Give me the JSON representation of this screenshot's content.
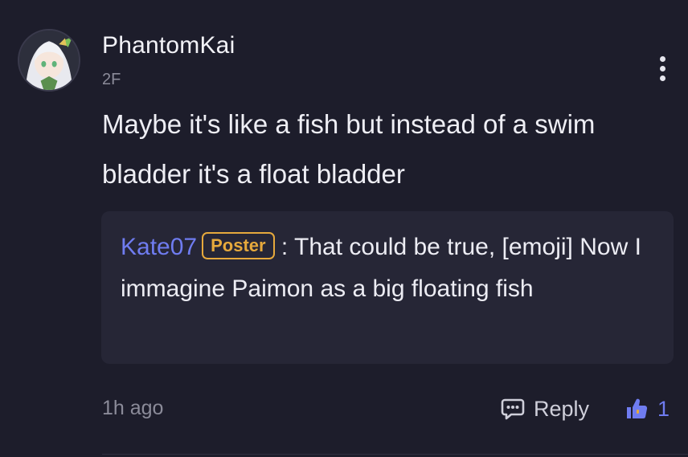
{
  "comment": {
    "username": "PhantomKai",
    "floor": "2F",
    "text": "Maybe it's like a fish but instead of a swim bladder it's a float bladder",
    "quote": {
      "author": "Kate07",
      "badge": "Poster",
      "separator": " : ",
      "text": "That could be true, [emoji] Now I immagine Paimon as a big floating fish"
    },
    "time": "1h ago",
    "reply_label": "Reply",
    "like_count": "1"
  },
  "icons": {
    "more": "more-vertical-icon",
    "reply": "comment-bubble-icon",
    "like": "thumbs-up-icon"
  },
  "colors": {
    "background": "#1d1d2b",
    "quote_background": "#262636",
    "accent": "#6f7cf0",
    "badge": "#e6a93c",
    "muted": "#8b8b99"
  }
}
